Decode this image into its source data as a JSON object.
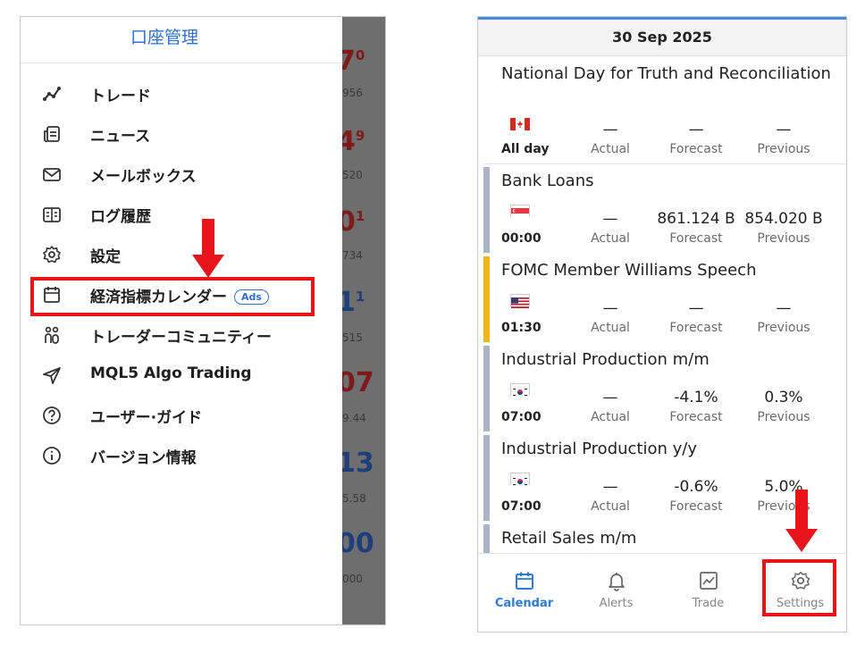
{
  "drawer": {
    "title": "口座管理",
    "items": [
      {
        "label": "トレード",
        "icon": "trade-chart-icon"
      },
      {
        "label": "ニュース",
        "icon": "news-icon"
      },
      {
        "label": "メールボックス",
        "icon": "mail-icon"
      },
      {
        "label": "ログ履歴",
        "icon": "log-history-icon"
      },
      {
        "label": "設定",
        "icon": "gear-icon"
      },
      {
        "label": "経済指標カレンダー",
        "icon": "calendar-icon",
        "badge": "Ads",
        "highlighted": true
      },
      {
        "label": "トレーダーコミュニティー",
        "icon": "community-icon"
      },
      {
        "label": "MQL5 Algo Trading",
        "icon": "send-icon"
      },
      {
        "label": "ユーザー·ガイド",
        "icon": "help-icon"
      },
      {
        "label": "バージョン情報",
        "icon": "info-icon"
      }
    ]
  },
  "background_quotes": [
    {
      "big": "7",
      "sup": "0",
      "small": "956",
      "color": "red"
    },
    {
      "big": "4",
      "sup": "9",
      "small": "520",
      "color": "red"
    },
    {
      "big": "0",
      "sup": "1",
      "small": "734",
      "color": "red"
    },
    {
      "big": "1",
      "sup": "1",
      "small": "515",
      "color": "blue"
    },
    {
      "big": "07",
      "sup": "",
      "small": "9.44",
      "color": "red"
    },
    {
      "big": "13",
      "sup": "",
      "small": "5.58",
      "color": "blue"
    },
    {
      "big": "00",
      "sup": "",
      "small": "000",
      "color": "blue"
    }
  ],
  "calendar": {
    "date": "30 Sep 2025",
    "captions": {
      "actual": "Actual",
      "forecast": "Forecast",
      "previous": "Previous"
    },
    "events": [
      {
        "name": "National Day for Truth and Reconciliation",
        "country": "canada-flag-icon",
        "time": "All day",
        "actual": "—",
        "forecast": "—",
        "previous": "—",
        "importance_color": "#ffffff"
      },
      {
        "name": "Bank Loans",
        "country": "singapore-flag-icon",
        "time": "00:00",
        "actual": "—",
        "forecast": "861.124 B",
        "previous": "854.020 B",
        "importance_color": "#a9b4c6"
      },
      {
        "name": "FOMC Member Williams Speech",
        "country": "usa-flag-icon",
        "time": "01:30",
        "actual": "—",
        "forecast": "—",
        "previous": "—",
        "importance_color": "#f2b61b"
      },
      {
        "name": "Industrial Production m/m",
        "country": "south-korea-flag-icon",
        "time": "07:00",
        "actual": "—",
        "forecast": "-4.1%",
        "previous": "0.3%",
        "importance_color": "#a9b4c6"
      },
      {
        "name": "Industrial Production y/y",
        "country": "south-korea-flag-icon",
        "time": "07:00",
        "actual": "—",
        "forecast": "-0.6%",
        "previous": "5.0%",
        "importance_color": "#a9b4c6"
      },
      {
        "name": "Retail Sales m/m",
        "country": "",
        "time": "",
        "actual": "",
        "forecast": "",
        "previous": "",
        "importance_color": "#a9b4c6"
      }
    ]
  },
  "tabbar": {
    "tabs": [
      {
        "label": "Calendar",
        "icon": "calendar-icon",
        "active": true
      },
      {
        "label": "Alerts",
        "icon": "bell-icon",
        "active": false
      },
      {
        "label": "Trade",
        "icon": "trade-chart-icon",
        "active": false
      },
      {
        "label": "Settings",
        "icon": "gear-icon",
        "active": false,
        "highlighted": true
      }
    ]
  },
  "colors": {
    "accent": "#2f7ad6",
    "highlight": "#e8141a"
  }
}
